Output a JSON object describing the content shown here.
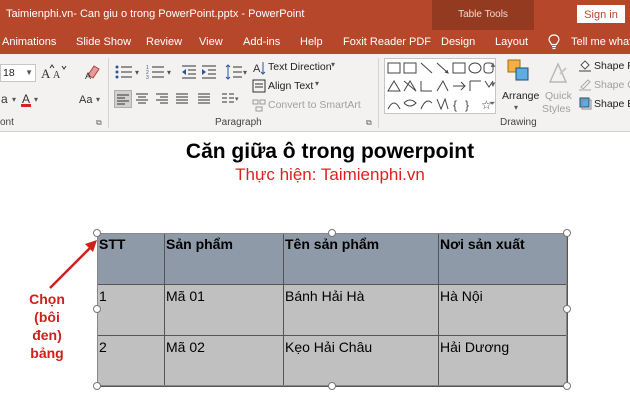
{
  "window": {
    "title": "Taimienphi.vn- Can giu o trong PowerPoint.pptx  -  PowerPoint",
    "context_tab_group": "Table Tools",
    "sign_in": "Sign in"
  },
  "tabs": [
    {
      "label": "Animations"
    },
    {
      "label": "Slide Show"
    },
    {
      "label": "Review"
    },
    {
      "label": "View"
    },
    {
      "label": "Add-ins"
    },
    {
      "label": "Help"
    },
    {
      "label": "Foxit Reader PDF"
    },
    {
      "label": "Design"
    },
    {
      "label": "Layout"
    },
    {
      "label": "Tell me what"
    }
  ],
  "ribbon": {
    "font_size": "18",
    "text_direction": "Text Direction",
    "align_text": "Align Text",
    "convert_smartart": "Convert to SmartArt",
    "arrange": "Arrange",
    "quick_styles_1": "Quick",
    "quick_styles_2": "Styles",
    "shape_fill": "Shape F",
    "shape_outline": "Shape O",
    "shape_effects": "Shape E",
    "group_font": "ont",
    "group_paragraph": "Paragraph",
    "group_drawing": "Drawing"
  },
  "slide": {
    "title": "Căn giữa ô trong powerpoint",
    "subtitle": "Thực hiện: Taimienphi.vn",
    "table": {
      "headers": [
        "STT",
        "Sản phẩm",
        "Tên sản phẩm",
        "Nơi sản xuất"
      ],
      "rows": [
        [
          "1",
          "Mã 01",
          "Bánh Hải Hà",
          " Hà Nội"
        ],
        [
          "2",
          "Mã 02",
          "Kẹo Hải Châu",
          " Hải Dương"
        ]
      ]
    },
    "callout": {
      "line1": "Chọn",
      "line2": "(bôi đen)",
      "line3": "bảng"
    }
  },
  "colors": {
    "accent": "#b7472a",
    "context_tab": "#943a21",
    "header_cell": "#8e9aa7",
    "body_cell": "#c0c0c0",
    "callout": "#d0201c",
    "subtitle": "#e02020"
  }
}
